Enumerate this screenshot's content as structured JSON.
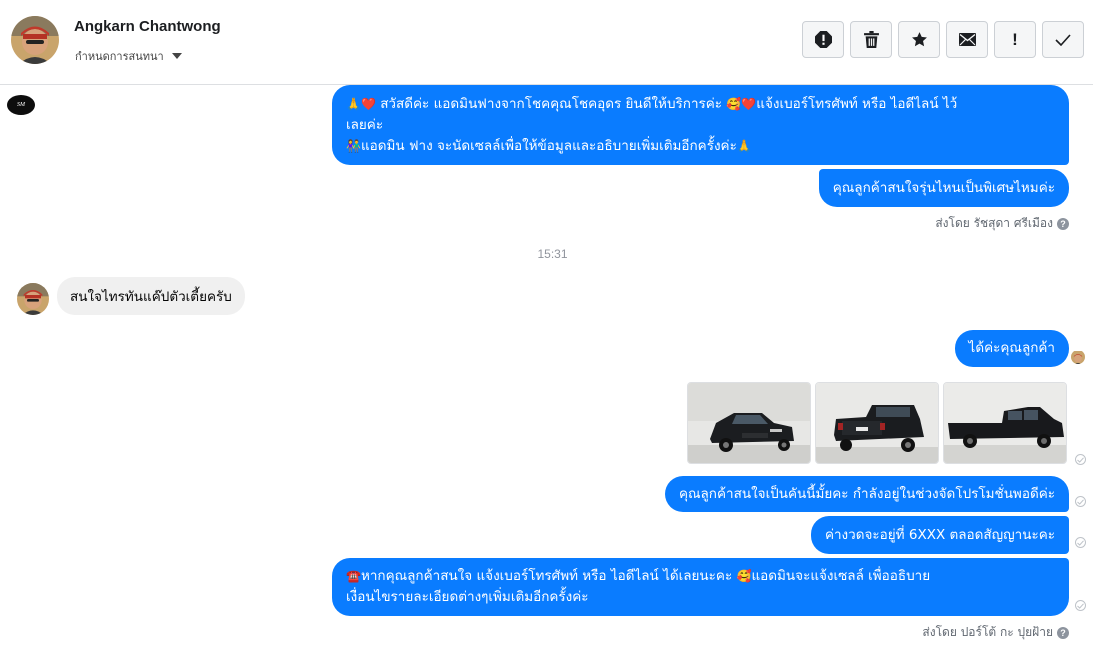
{
  "header": {
    "contact_name": "Angkarn Chantwong",
    "conversation_settings": "กำหนดการสนทนา",
    "toolbar": [
      "report-icon",
      "trash-icon",
      "star-icon",
      "envelope-icon",
      "!",
      "check-icon"
    ],
    "toolbar_exclaim": "!"
  },
  "thread": {
    "page_logo_text": "SM",
    "messages": [
      {
        "line1_pre": "🙏",
        "line1_heart": "❤️",
        "line1_text": " สวัสดีค่ะ แอดมินฟางจากโชคคุณโชคอุดร ยินดีให้บริการค่ะ ",
        "line1_emoji2": "🥰❤️",
        "line1_text2": "แจ้งเบอร์โทรศัพท์ หรือ ไอดีไลน์  ไว้",
        "line2": "เลยค่ะ",
        "line3_emoji": "👫",
        "line3_text": "แอดมิน ฟาง จะนัดเซลล์เพื่อให้ข้อมูลและอธิบายเพิ่มเติมอีกครั้งค่ะ",
        "line3_end": "🙏"
      },
      {
        "text": "คุณลูกค้าสนใจรุ่นไหนเป็นพิเศษไหมค่ะ"
      }
    ],
    "sent_by_1": "ส่งโดย รัชสุดา ศรีเมือง",
    "help_mark": "?",
    "timestamp": "15:31",
    "incoming": "สนใจไทรทันแค๊ปตัวเตี้ยครับ",
    "reply_1": "ได้ค่ะคุณลูกค้า",
    "photos": [
      "photo-truck-front",
      "photo-truck-rear",
      "photo-truck-side"
    ],
    "reply_2": "คุณลูกค้าสนใจเป็นคันนี้มั้ยคะ กำลังอยู่ในช่วงจัดโปรโมชั่นพอดีค่ะ",
    "reply_3": "ค่างวดจะอยู่ที่ 6XXX ตลอดสัญญานะคะ",
    "reply_4_emoji": "☎️",
    "reply_4_line1": "หากคุณลูกค้าสนใจ แจ้งเบอร์โทรศัพท์ หรือ ไอดีไลน์  ได้เลยนะคะ ",
    "reply_4_emoji2": "🥰",
    "reply_4_line1b": "แอดมินจะแจ้งเซลล์   เพื่ออธิบาย",
    "reply_4_line2": "เงื่อนไขรายละเอียดต่างๆเพิ่มเติมอีกครั้งค่ะ",
    "sent_by_2": "ส่งโดย ปอร์โต้ กะ ปุยฝ้าย"
  },
  "colors": {
    "bubble_out": "#0a7cff",
    "bubble_in": "#f0f0f0",
    "meta_text": "#606770"
  }
}
